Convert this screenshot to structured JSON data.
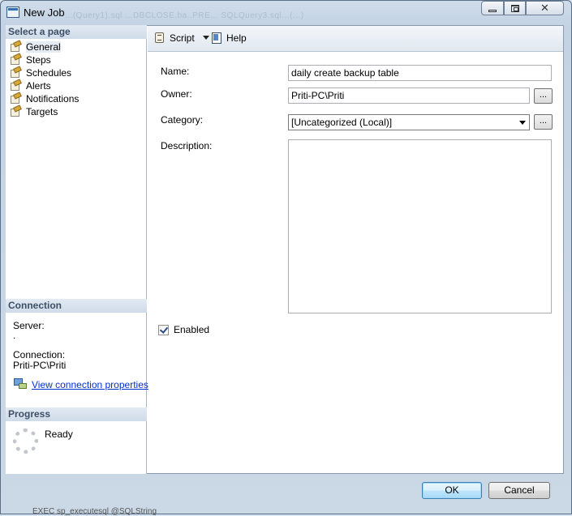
{
  "window": {
    "title": "New Job",
    "background_ghost_text": "...(Query1).sql ...DBCLOSE.ba..PRE... SQLQuery3.sql...(...)",
    "buttons": {
      "minimize": "minimize",
      "maximize": "maximize",
      "close": "✕"
    }
  },
  "left_panel": {
    "select_page_heading": "Select a page",
    "pages": [
      {
        "label": "General",
        "icon": "page-wrench-icon",
        "selected": true
      },
      {
        "label": "Steps",
        "icon": "page-wrench-icon"
      },
      {
        "label": "Schedules",
        "icon": "page-wrench-icon"
      },
      {
        "label": "Alerts",
        "icon": "page-wrench-icon"
      },
      {
        "label": "Notifications",
        "icon": "page-wrench-icon"
      },
      {
        "label": "Targets",
        "icon": "page-wrench-icon"
      }
    ],
    "connection_heading": "Connection",
    "server_label": "Server:",
    "server_value": ".",
    "connection_label": "Connection:",
    "connection_value": "Priti-PC\\Priti",
    "view_connection_link": "View connection properties",
    "progress_heading": "Progress",
    "progress_status": "Ready"
  },
  "toolbar": {
    "script_label": "Script",
    "help_label": "Help"
  },
  "form": {
    "name_label": "Name:",
    "name_value": "daily create backup table",
    "owner_label": "Owner:",
    "owner_value": "Priti-PC\\Priti",
    "owner_browse": "...",
    "category_label": "Category:",
    "category_value": "[Uncategorized (Local)]",
    "category_browse": "...",
    "description_label": "Description:",
    "description_value": "",
    "enabled_label": "Enabled",
    "enabled_checked": true
  },
  "footer": {
    "ok_label": "OK",
    "cancel_label": "Cancel",
    "behind_text": "EXEC sp_executesql @SQLString"
  }
}
